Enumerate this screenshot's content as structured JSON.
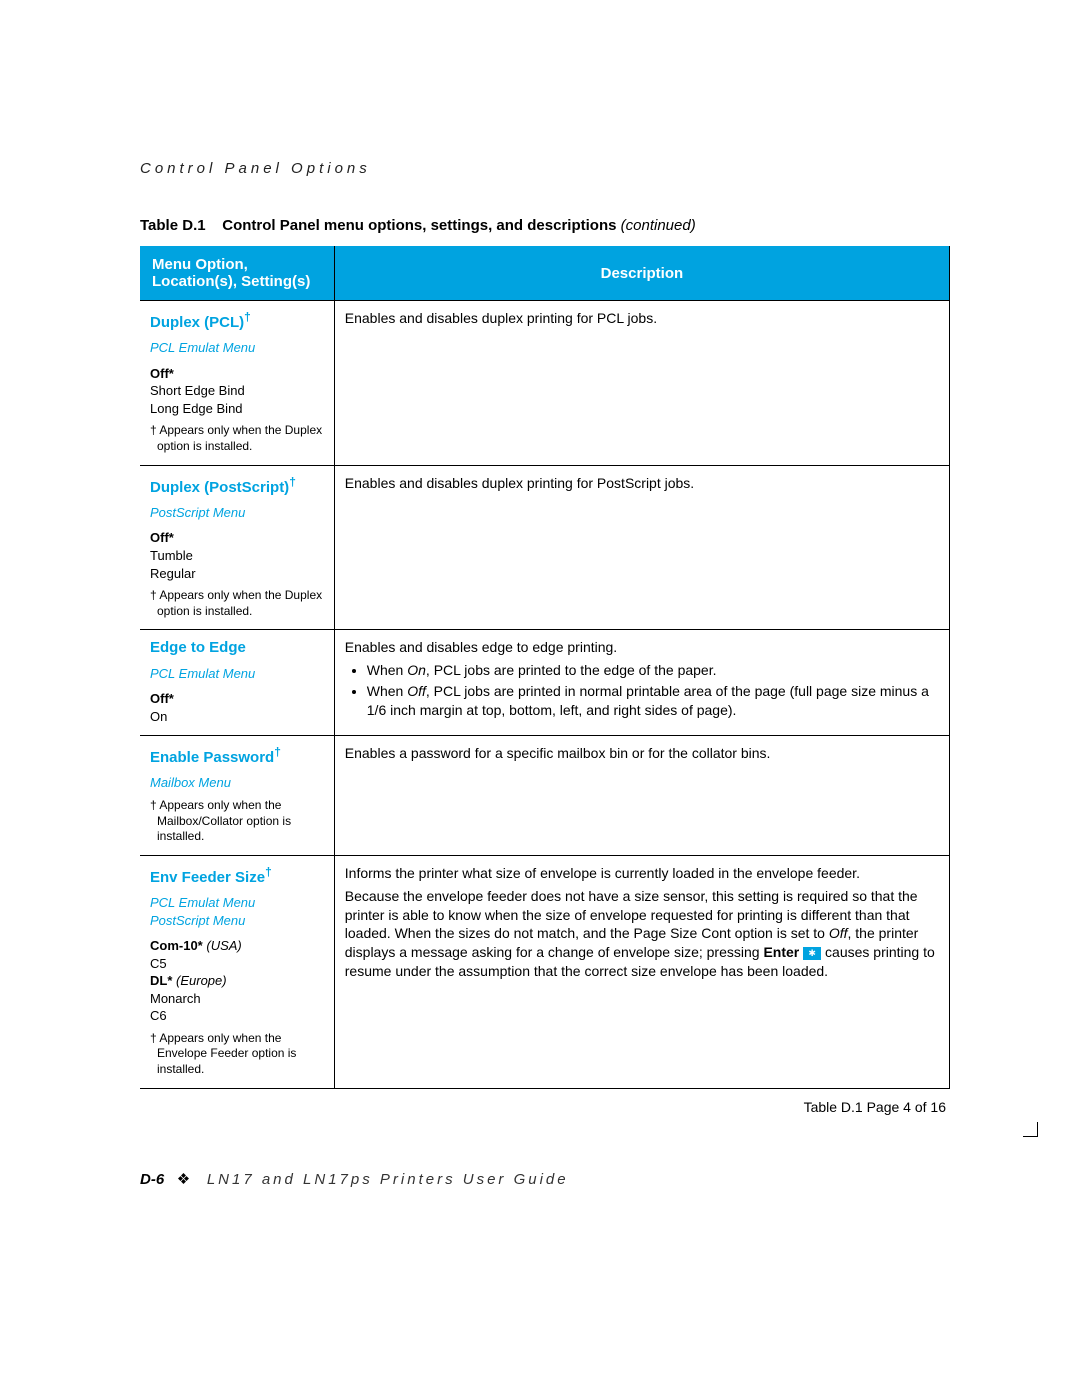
{
  "header": {
    "section": "Control Panel Options"
  },
  "caption": {
    "label": "Table D.1",
    "title": "Control Panel menu options, settings, and descriptions",
    "continued": "(continued)"
  },
  "columns": {
    "left": "Menu Option, Location(s), Setting(s)",
    "right": "Description"
  },
  "rows": [
    {
      "title": "Duplex (PCL)",
      "dagger": "†",
      "menu": "PCL Emulat Menu",
      "settings_html": "<b>Off*</b><br>Short Edge Bind<br>Long Edge Bind",
      "footnote": "† Appears only when the Duplex option is installed.",
      "description": "Enables and disables duplex printing for PCL jobs."
    },
    {
      "title": "Duplex (PostScript)",
      "dagger": "†",
      "menu": "PostScript Menu",
      "settings_html": "<b>Off*</b><br>Tumble<br>Regular",
      "footnote": "† Appears only when the Duplex option is installed.",
      "description": "Enables and disables duplex printing for PostScript jobs."
    },
    {
      "title": "Edge to Edge",
      "dagger": "",
      "menu": "PCL Emulat Menu",
      "settings_html": "<b>Off*</b><br>On",
      "footnote": "",
      "description_intro": "Enables and disables edge to edge printing.",
      "bullets": [
        "When <i>On</i>, PCL jobs are printed to the edge of the paper.",
        "When <i>Off</i>, PCL jobs are printed in normal printable area of the page (full page size minus a 1/6 inch margin at top, bottom, left, and right sides of page)."
      ]
    },
    {
      "title": "Enable Password",
      "dagger": "†",
      "menu": "Mailbox Menu",
      "settings_html": "",
      "footnote": "† Appears only when the Mailbox/Collator option is installed.",
      "description": "Enables a password for a specific mailbox bin or for the collator bins."
    },
    {
      "title": "Env Feeder Size",
      "dagger": "†",
      "menu": "PCL Emulat Menu",
      "menu2": "PostScript Menu",
      "settings_html": "<b>Com-10*</b> <span class=\"reg-italic\">(USA)</span><br>C5<br><b>DL*</b> <span class=\"reg-italic\">(Europe)</span><br>Monarch<br>C6",
      "footnote": "† Appears only when the Envelope Feeder option is installed.",
      "description_p1": "Informs the printer what size of envelope is currently loaded in the envelope feeder.",
      "description_p2_a": "Because the envelope feeder does not have a size sensor, this setting is required so that the printer is able to know when the size of envelope requested for printing is different than that loaded. When the sizes do not match, and the Page Size Cont option is set to ",
      "description_p2_off": "Off",
      "description_p2_b": ", the printer displays a message asking for a change of envelope size; pressing ",
      "description_enter": "Enter",
      "enter_glyph": "✱",
      "description_p2_c": " causes printing to resume under the assumption that the correct size envelope has been loaded."
    }
  ],
  "pager": "Table D.1  Page 4 of 16",
  "footer": {
    "page": "D-6",
    "diamond": "❖",
    "guide": "LN17 and LN17ps Printers User Guide"
  }
}
